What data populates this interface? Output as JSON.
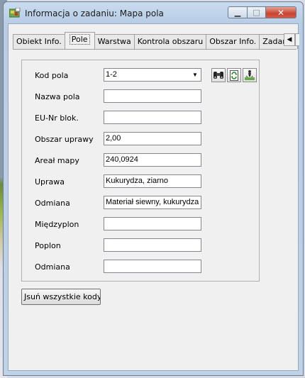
{
  "window": {
    "title": "Informacja o zadaniu: Mapa pola",
    "close_glyph": "✕",
    "max_glyph": "□",
    "min_glyph": "▁"
  },
  "tabs": [
    {
      "label": "Obiekt Info."
    },
    {
      "label": "Pole",
      "active": true
    },
    {
      "label": "Warstwa"
    },
    {
      "label": "Kontrola obszaru"
    },
    {
      "label": "Obszar Info."
    },
    {
      "label": "Zadanie"
    }
  ],
  "tab_scroll_left_glyph": "◀",
  "form": {
    "kod_pola": {
      "label": "Kod pola",
      "value": "1-2"
    },
    "nazwa_pola": {
      "label": "Nazwa pola",
      "value": ""
    },
    "eu_nr_blok": {
      "label": "EU-Nr blok.",
      "value": ""
    },
    "obszar_uprawy": {
      "label": "Obszar uprawy",
      "value": "2,00"
    },
    "areal_mapy": {
      "label": "Areał mapy",
      "value": "240,0924"
    },
    "uprawa": {
      "label": "Uprawa",
      "value": "Kukurydza, ziarno"
    },
    "odmiana1": {
      "label": "Odmiana",
      "value": "Materiał siewny, kukurydza"
    },
    "miedzyplon": {
      "label": "Międzyplon",
      "value": ""
    },
    "poplon": {
      "label": "Poplon",
      "value": ""
    },
    "odmiana2": {
      "label": "Odmiana",
      "value": ""
    }
  },
  "toolbar_icons": [
    "binoculars-icon",
    "refresh-icon",
    "field-person-icon"
  ],
  "buttons": {
    "move_all_codes": "Jsuń wszystkie kody pó"
  },
  "colors": {
    "close_button": "#c9432f",
    "title_bar": "#c9dbee",
    "client_bg": "#f0f0f0"
  }
}
